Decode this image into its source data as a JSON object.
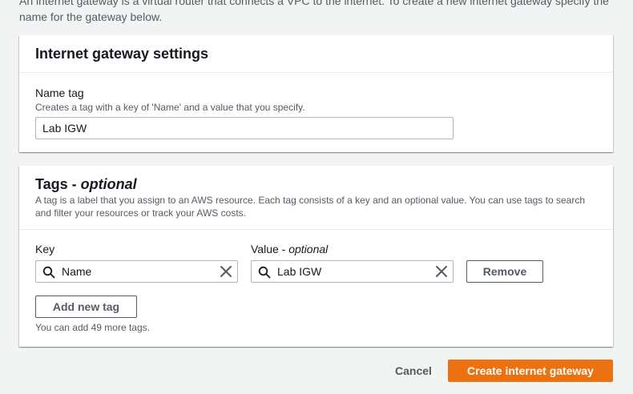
{
  "intro_text": "An internet gateway is a virtual router that connects a VPC to the internet. To create a new internet gateway specify the name for the gateway below.",
  "settings_panel": {
    "title": "Internet gateway settings",
    "name_tag": {
      "label": "Name tag",
      "description": "Creates a tag with a key of 'Name' and a value that you specify.",
      "value": "Lab IGW"
    }
  },
  "tags_panel": {
    "title": "Tags - ",
    "title_optional": "optional",
    "description": "A tag is a label that you assign to an AWS resource. Each tag consists of a key and an optional value. You can use tags to search and filter your resources or track your AWS costs.",
    "key_label": "Key",
    "value_label": "Value - ",
    "value_label_optional": "optional",
    "rows": [
      {
        "key": "Name",
        "value": "Lab IGW",
        "remove_label": "Remove"
      }
    ],
    "add_tag_label": "Add new tag",
    "limit_text": "You can add 49 more tags."
  },
  "footer": {
    "cancel_label": "Cancel",
    "create_label": "Create internet gateway"
  },
  "colors": {
    "primary": "#ec7211",
    "background": "#f2f3f3",
    "text_secondary": "#545b64"
  }
}
